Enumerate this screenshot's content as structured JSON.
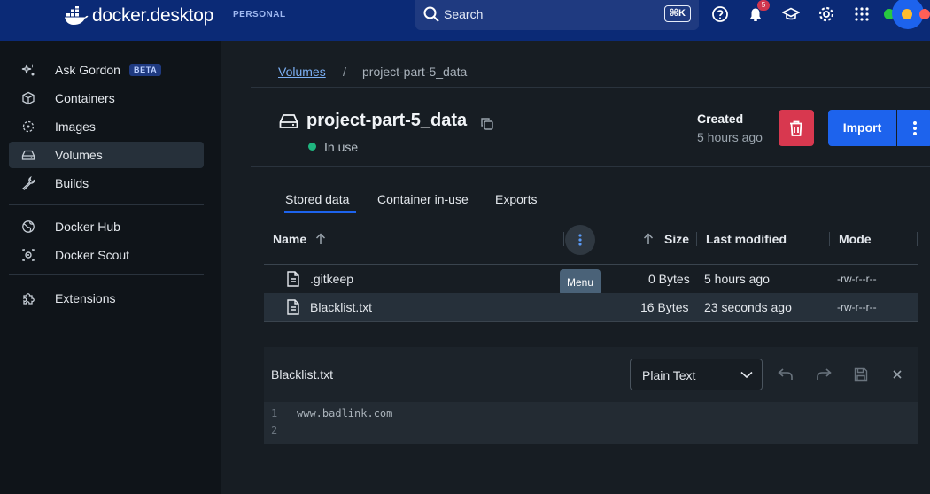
{
  "topbar": {
    "brand": "docker.desktop",
    "plan": "PERSONAL",
    "search_label": "Search",
    "search_shortcut": "⌘K",
    "notification_count": "5",
    "colors": {
      "bar": "#0b2a76",
      "accent": "#1d63ed"
    }
  },
  "sidebar": {
    "items": [
      {
        "label": "Ask Gordon",
        "badge": "BETA",
        "icon": "sparkle-icon"
      },
      {
        "label": "Containers",
        "icon": "cube-icon"
      },
      {
        "label": "Images",
        "icon": "image-layers-icon"
      },
      {
        "label": "Volumes",
        "icon": "drive-icon",
        "active": true
      },
      {
        "label": "Builds",
        "icon": "wrench-icon"
      },
      {
        "label": "Docker Hub",
        "icon": "globe-icon"
      },
      {
        "label": "Docker Scout",
        "icon": "scout-icon"
      },
      {
        "label": "Extensions",
        "icon": "puzzle-icon"
      }
    ]
  },
  "breadcrumb": {
    "parent": "Volumes",
    "separator": "/",
    "current": "project-part-5_data"
  },
  "volume": {
    "name": "project-part-5_data",
    "status": "In use",
    "created_label": "Created",
    "created_value": "5 hours ago",
    "import_label": "Import"
  },
  "tabs": [
    "Stored data",
    "Container in-use",
    "Exports"
  ],
  "table": {
    "headers": {
      "name": "Name",
      "size": "Size",
      "modified": "Last modified",
      "mode": "Mode"
    },
    "menu_tooltip": "Menu",
    "rows": [
      {
        "name": ".gitkeep",
        "size": "0 Bytes",
        "modified": "5 hours ago",
        "mode": "-rw-r--r--"
      },
      {
        "name": "Blacklist.txt",
        "size": "16 Bytes",
        "modified": "23 seconds ago",
        "mode": "-rw-r--r--",
        "selected": true
      }
    ]
  },
  "editor": {
    "file_name": "Blacklist.txt",
    "language": "Plain Text",
    "lines": [
      {
        "num": "1",
        "text": "www.badlink.com"
      },
      {
        "num": "2",
        "text": ""
      }
    ]
  }
}
